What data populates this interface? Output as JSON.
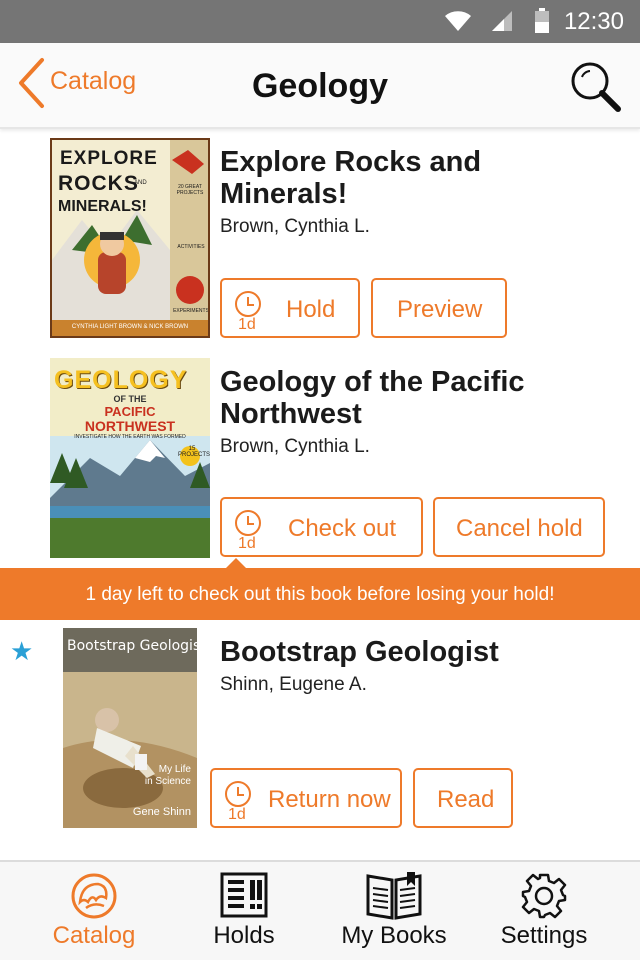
{
  "status_bar": {
    "time": "12:30",
    "icons": [
      "wifi-icon",
      "signal-icon",
      "battery-icon"
    ]
  },
  "header": {
    "back_label": "Catalog",
    "title": "Geology",
    "search_icon": "search-icon"
  },
  "books": [
    {
      "title_line1": "Explore Rocks and",
      "title_line2": "Minerals!",
      "author": "Brown, Cynthia L.",
      "cover_text": {
        "line1": "EXPLORE",
        "line2": "ROCKS",
        "line2b": "AND",
        "line3": "MINERALS!",
        "badge": "20 GREAT PROJECTS",
        "side1": "ACTIVITIES",
        "side2": "EXPERIMENTS",
        "footer": "CYNTHIA LIGHT BROWN & NICK BROWN"
      },
      "buttons": [
        {
          "label": "Hold",
          "due": "1d"
        },
        {
          "label": "Preview"
        }
      ]
    },
    {
      "title_line1": "Geology of the Pacific",
      "title_line2": "Northwest",
      "author": "Brown, Cynthia L.",
      "cover_text": {
        "line1": "GEOLOGY",
        "line2": "OF THE",
        "line3": "PACIFIC",
        "line4": "NORTHWEST",
        "sub": "INVESTIGATE HOW THE EARTH WAS FORMED",
        "badge": "15 PROJECTS"
      },
      "buttons": [
        {
          "label": "Check out",
          "due": "1d"
        },
        {
          "label": "Cancel hold"
        }
      ]
    },
    {
      "title_line1": "Bootstrap Geologist",
      "title_line2": "",
      "author": "Shinn, Eugene A.",
      "starred": true,
      "cover_text": {
        "title": "Bootstrap Geologist",
        "subtitle1": "My Life",
        "subtitle2": "in Science",
        "author": "Gene Shinn"
      },
      "buttons": [
        {
          "label": "Return now",
          "due": "1d"
        },
        {
          "label": "Read"
        }
      ]
    }
  ],
  "banner": {
    "text": "1 day left to check out this book before losing your hold!"
  },
  "bottom_nav": [
    {
      "label": "Catalog",
      "icon": "lion-icon",
      "active": true
    },
    {
      "label": "Holds",
      "icon": "holds-icon",
      "active": false
    },
    {
      "label": "My Books",
      "icon": "books-icon",
      "active": false
    },
    {
      "label": "Settings",
      "icon": "gear-icon",
      "active": false
    }
  ],
  "colors": {
    "accent": "#ee7a2a",
    "star": "#2aa0d6",
    "status_bar": "#757575"
  }
}
